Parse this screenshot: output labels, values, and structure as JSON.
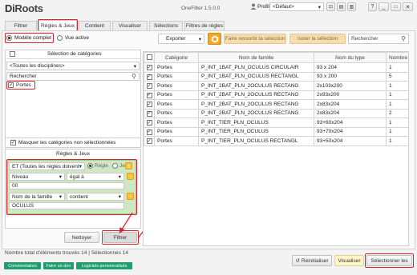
{
  "app": {
    "logo_di": "Di",
    "logo_roots": "Roots",
    "version": "OneFilter 1.5.0.0"
  },
  "titlebar": {
    "profile_label": "Profil",
    "profile_value": "<Défaut>",
    "help": "?"
  },
  "tabs": [
    "Filtrer",
    "Règles & Jeux",
    "Contient",
    "Visualiser",
    "Sélections",
    "Filtres de règles"
  ],
  "mode": {
    "model_complete": "Modèle complet",
    "active_view": "Vue active"
  },
  "toolbar": {
    "export": "Exporter",
    "refresh_icon": "hexagon-refresh-icon",
    "highlight": "Faire ressortir la sélection",
    "isolate": "Isoler la sélection",
    "search_placeholder": "Rechercher"
  },
  "categories": {
    "title": "Sélection de catégories",
    "disciplines_value": "<Toutes les disciplines>",
    "search_placeholder": "Rechercher",
    "items": [
      {
        "label": "Portes",
        "checked": true
      }
    ],
    "hide_unselected": "Masquer les catégories non sélectionnées"
  },
  "rules": {
    "title": "Règles & Jeux",
    "header_select": "ET (Toutes les règles doivent",
    "radio_rule": "Règle",
    "radio_set": "Jeu",
    "rule1": {
      "param": "Niveau",
      "operator": "égal à",
      "value": "00"
    },
    "rule2": {
      "param": "Nom de la famille",
      "operator": "contient",
      "value": "OCULUS"
    }
  },
  "actions": {
    "reset": "Nettoyer",
    "filter": "Filtrer"
  },
  "table": {
    "headers": [
      "",
      "Catégorie",
      "Nom de famille",
      "Nom du type",
      "Nombre"
    ],
    "rows": [
      {
        "cat": "Portes",
        "family": "P_INT_1BAT_PLN_OCULUS CIRCULAIR",
        "type": "93 x 204",
        "count": "1"
      },
      {
        "cat": "Portes",
        "family": "P_INT_1BAT_PLN_OCULUS RECTANGL",
        "type": "93 x 200",
        "count": "5"
      },
      {
        "cat": "Portes",
        "family": "P_INT_2BAT_PLN_2OCULUS RECTANG",
        "type": "2x103x200",
        "count": "1"
      },
      {
        "cat": "Portes",
        "family": "P_INT_2BAT_PLN_2OCULUS RECTANG",
        "type": "2x93x200",
        "count": "1"
      },
      {
        "cat": "Portes",
        "family": "P_INT_2BAT_PLN_2OCULUS RECTANG",
        "type": "2x83x204",
        "count": "1"
      },
      {
        "cat": "Portes",
        "family": "P_INT_2BAT_PLN_2OCULUS RECTANG",
        "type": "2x83x204",
        "count": "2"
      },
      {
        "cat": "Portes",
        "family": "P_INT_TIER_PLN_OCULUS",
        "type": "93+60x204",
        "count": "1"
      },
      {
        "cat": "Portes",
        "family": "P_INT_TIER_PLN_OCULUS",
        "type": "93+70x204",
        "count": "1"
      },
      {
        "cat": "Portes",
        "family": "P_INT_TIER_PLN_OCULUS RECTANGL",
        "type": "93+50x204",
        "count": "1"
      }
    ]
  },
  "status": {
    "total": "Nombre total d'éléments trouvés 14 | Sélectionnés 14"
  },
  "bottom": {
    "reinit": "Réinitialiser",
    "visualize": "Visualiser",
    "select_all": "Sélectionner les"
  },
  "footer_links": [
    "Commentaires",
    "Faire un don",
    "Logiciels personnalisés"
  ],
  "colors": {
    "accent_red": "#d9232e",
    "green": "#1e9e6f",
    "visualize_bg": "#fff5c9"
  }
}
